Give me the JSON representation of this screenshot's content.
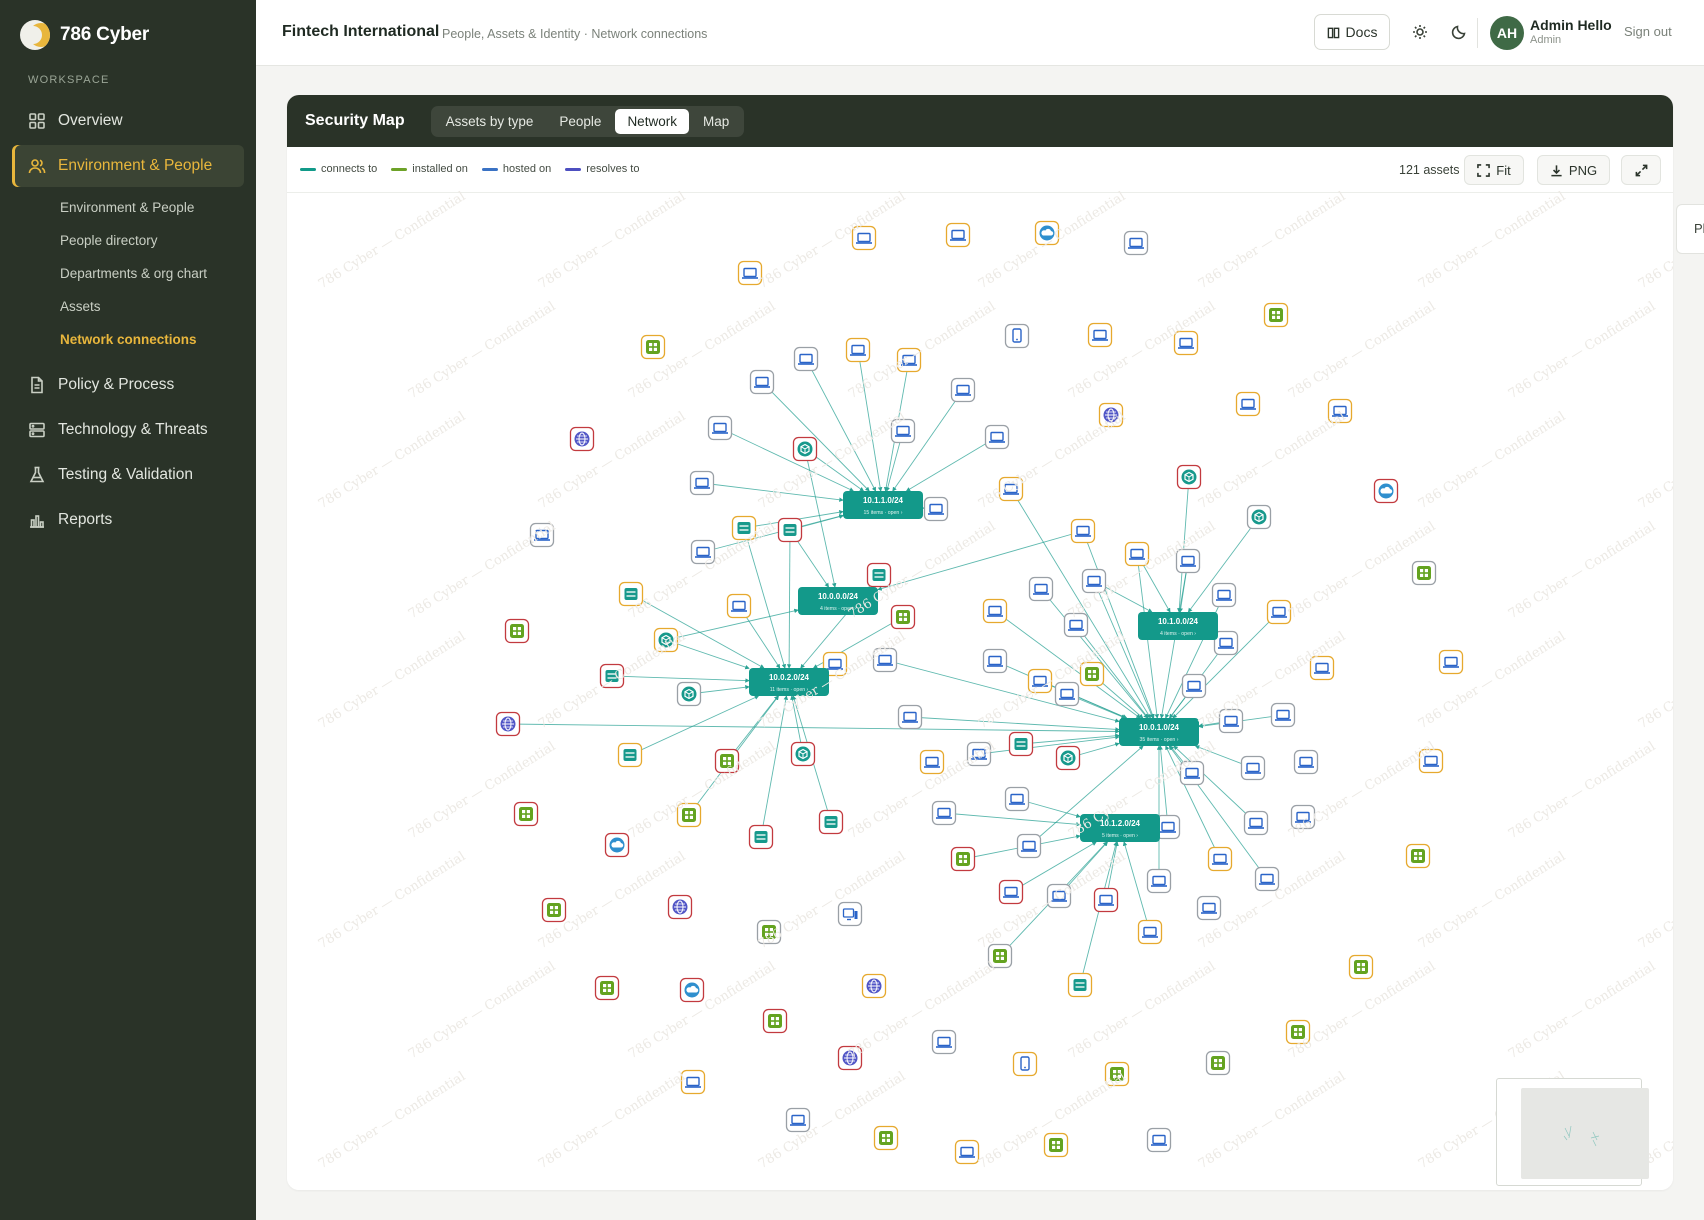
{
  "brand": {
    "name": "786 Cyber"
  },
  "sidebar": {
    "section_label": "WORKSPACE",
    "items": [
      {
        "label": "Overview",
        "icon": "grid-icon",
        "active": false
      },
      {
        "label": "Environment & People",
        "icon": "people-icon",
        "active": true
      },
      {
        "label": "Policy & Process",
        "icon": "document-icon",
        "active": false
      },
      {
        "label": "Technology & Threats",
        "icon": "server-icon",
        "active": false
      },
      {
        "label": "Testing & Validation",
        "icon": "flask-icon",
        "active": false
      },
      {
        "label": "Reports",
        "icon": "bar-chart-icon",
        "active": false
      }
    ],
    "subitems": [
      {
        "label": "Environment & People",
        "active": false
      },
      {
        "label": "People directory",
        "active": false
      },
      {
        "label": "Departments & org chart",
        "active": false
      },
      {
        "label": "Assets",
        "active": false
      },
      {
        "label": "Network connections",
        "active": true
      }
    ]
  },
  "header": {
    "org": "Fintech International",
    "breadcrumb": "People, Assets & Identity · Network connections",
    "docs_label": "Docs",
    "user_initials": "AH",
    "user_name": "Admin Hello",
    "user_role": "Admin",
    "signout_label": "Sign out"
  },
  "card": {
    "title": "Security Map",
    "tabs": [
      {
        "label": "Assets by type",
        "active": false
      },
      {
        "label": "People",
        "active": false
      },
      {
        "label": "Network",
        "active": true
      },
      {
        "label": "Map",
        "active": false
      }
    ],
    "legend": [
      {
        "label": "connects to",
        "color": "#119a89"
      },
      {
        "label": "installed on",
        "color": "#6da228"
      },
      {
        "label": "hosted on",
        "color": "#3a72c4"
      },
      {
        "label": "resolves to",
        "color": "#4d4fc0"
      }
    ],
    "assets_count": "121 assets",
    "fit_label": "Fit",
    "png_label": "PNG",
    "right_tab_label": "Pl"
  },
  "graph": {
    "watermark": "786 Cyber — Confidential",
    "hubs": [
      {
        "id": "h1",
        "label": "10.1.1.0/24",
        "sub": "15 items · open ›"
      },
      {
        "id": "h2",
        "label": "10.0.0.0/24",
        "sub": "4 items · open ›"
      },
      {
        "id": "h3",
        "label": "10.0.2.0/24",
        "sub": "11 items · open ›"
      },
      {
        "id": "h4",
        "label": "10.1.0.0/24",
        "sub": "4 items · open ›"
      },
      {
        "id": "h5",
        "label": "10.0.1.0/24",
        "sub": "35 items · open ›"
      },
      {
        "id": "h6",
        "label": "10.1.2.0/24",
        "sub": "5 items · open ›"
      }
    ]
  },
  "colors": {
    "sidebar_bg": "#2a3328",
    "accent": "#e8b63c",
    "hub": "#13998a",
    "edge": "#2aa294",
    "border_amber": "#e6a92e",
    "border_red": "#c23a3f",
    "border_grey": "#9aa0a6",
    "icon_blue": "#2a64c8",
    "icon_green": "#64a320",
    "icon_teal": "#17998c",
    "icon_purple": "#5156c6"
  }
}
